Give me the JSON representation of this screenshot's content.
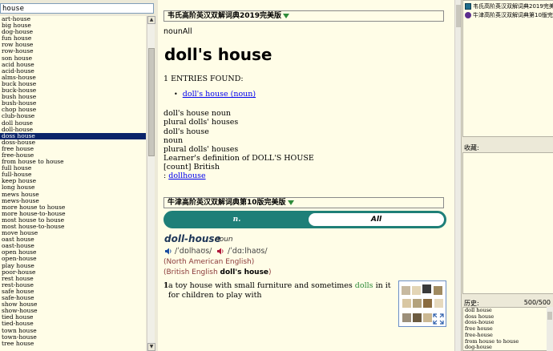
{
  "search": {
    "value": "house"
  },
  "wordlist": {
    "selected_index": 18,
    "items": [
      "art-house",
      "big house",
      "dog-house",
      "fun house",
      "row house",
      "row-house",
      "son house",
      "acid house",
      "acid-house",
      "alms-house",
      "buck house",
      "buck-house",
      "bush house",
      "bush-house",
      "chop house",
      "club-house",
      "doll house",
      "doll-house",
      "doss house",
      "doss-house",
      "free house",
      "free-house",
      "from house to house",
      "full house",
      "full-house",
      "keep house",
      "long house",
      "mews house",
      "mews-house",
      "more house to house",
      "more house-to-house",
      "most house to house",
      "most house-to-house",
      "move house",
      "oast house",
      "oast-house",
      "open house",
      "open-house",
      "play house",
      "poor-house",
      "rest house",
      "rest-house",
      "safe house",
      "safe-house",
      "show house",
      "show-house",
      "tied house",
      "tied-house",
      "town house",
      "town-house",
      "tree house"
    ]
  },
  "entry1": {
    "dict_name": "韦氏高阶英汉双解词典2019完美版",
    "label": "nounAll",
    "headword": "doll's house",
    "found": "1 ENTRIES FOUND:",
    "found_link": "doll's house (noun)",
    "lines": [
      "doll's house noun",
      "plural dolls' houses",
      "doll's house",
      "noun",
      "plural dolls' houses",
      "Learner's definition of DOLL'S HOUSE",
      "[count] British"
    ],
    "see_prefix": ": ",
    "see_link": "dollhouse"
  },
  "entry2": {
    "dict_name": "牛津高阶英汉双解词典第10版完美版",
    "tab_n": "n.",
    "tab_all": "All",
    "headword": "doll-house",
    "pos": "noun",
    "phon_br": "/ˈdɒlhaʊs/",
    "phon_am": "/ˈdɑːlhaʊs/",
    "region_am": "(North American English)",
    "region_br_prefix": "(British English ",
    "region_br_word": "doll's house",
    "region_br_suffix": ")",
    "sense_num": "1",
    "def_part1": "a toy house with small furniture and sometimes ",
    "def_xref": "dolls",
    "def_part2": " in it for children to play with"
  },
  "right": {
    "dicts": [
      "韦氏高阶英汉双解词典2019完美版",
      "牛津高阶英汉双解词典第10版完美版"
    ],
    "fav_label": "收藏:",
    "hist_label": "历史:",
    "hist_count": "500/500",
    "history": [
      "doll house",
      "doss house",
      "doss-house",
      "free house",
      "free-house",
      "from house to house",
      "dog-house"
    ]
  },
  "colors": {
    "selection": "#0a246a",
    "tab_accent": "#1e7f78",
    "link": "#0000ee",
    "xref": "#2e8b3a",
    "pane_bg": "#fffde7"
  },
  "icons": {
    "dropdown": "triangle-down-icon",
    "speaker": "speaker-icon",
    "expand": "expand-icon"
  }
}
